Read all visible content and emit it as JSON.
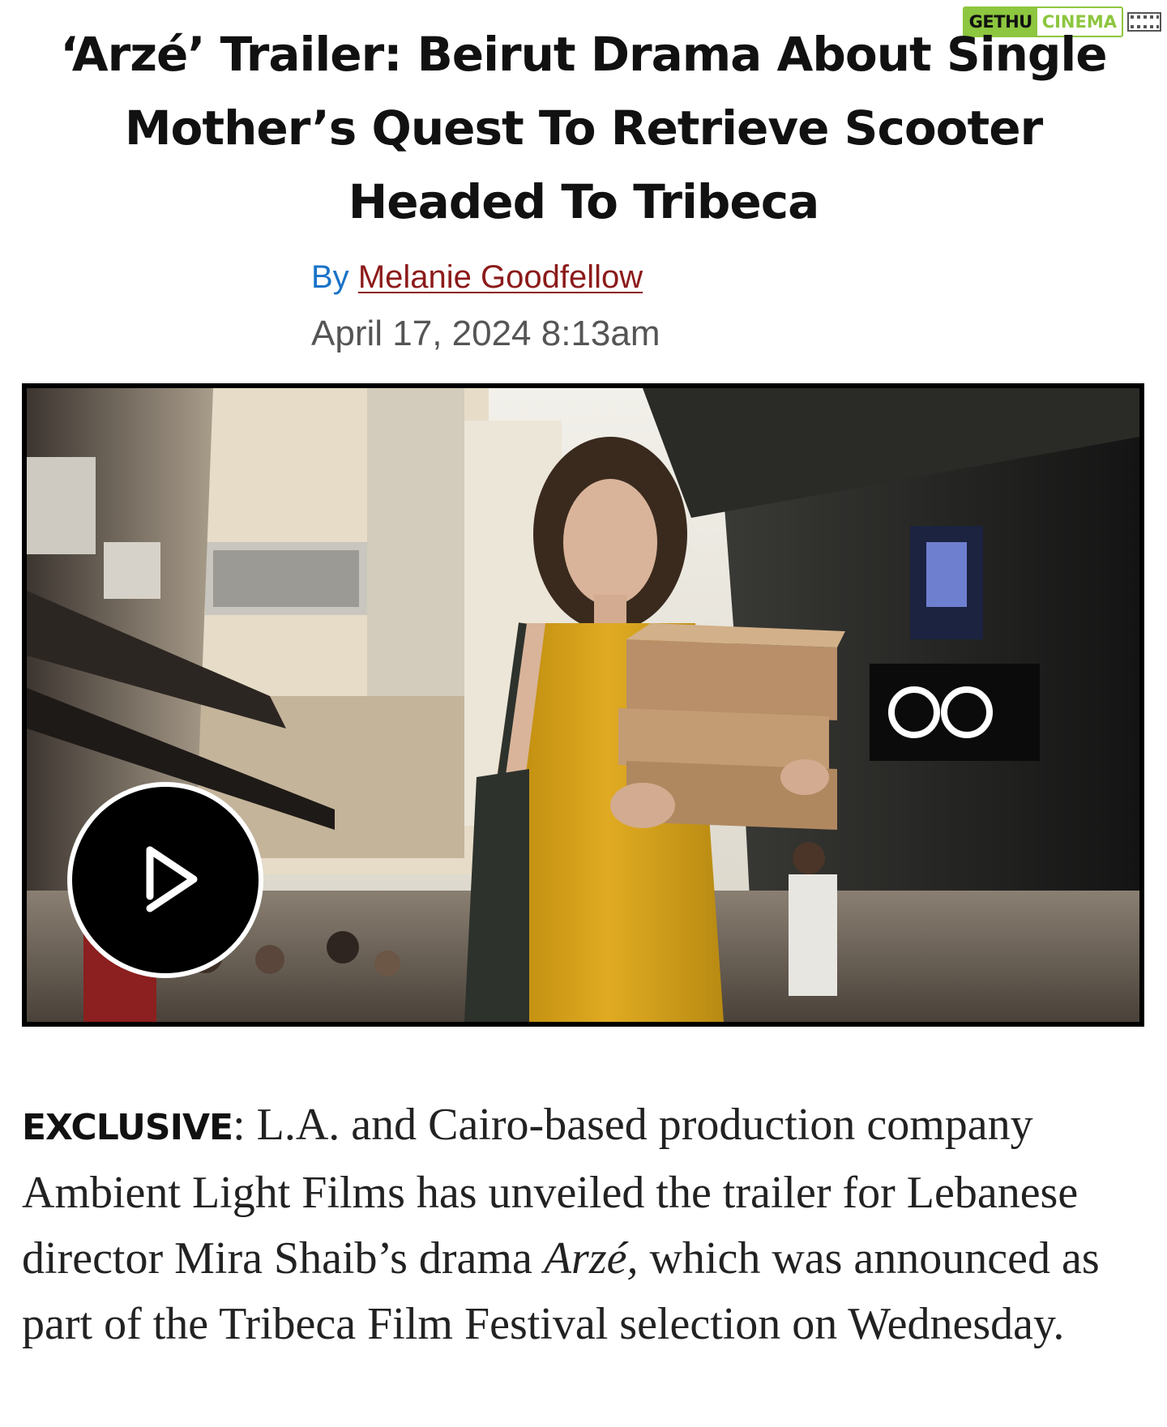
{
  "watermark": {
    "left_text": "GETHU",
    "right_text": "CINEMA",
    "color": "#8dc63f"
  },
  "article": {
    "headline": "‘Arzé’ Trailer: Beirut Drama About Single Mother’s Quest To Retrieve Scooter Headed To Tribeca",
    "byline_prefix": "By",
    "author": "Melanie Goodfellow",
    "date": "April 17, 2024 8:13am",
    "hero": {
      "play_icon": "play-icon",
      "sign_text": "ʘʘ"
    },
    "body": {
      "kicker": "EXCLUSIVE",
      "kicker_sep": ": ",
      "text_1": "L.A. and Cairo-based production company Ambient Light Films has unveiled the trailer for Lebanese director Mira Shaib’s drama ",
      "title_italic": "Arzé,",
      "text_2": " which was announced as part of the Tribeca Film Festival selection on Wednesday."
    }
  },
  "colors": {
    "byline_prefix": "#1a73c8",
    "author_link": "#8c1a1a",
    "date": "#555555",
    "dress": "#d9a31c"
  }
}
